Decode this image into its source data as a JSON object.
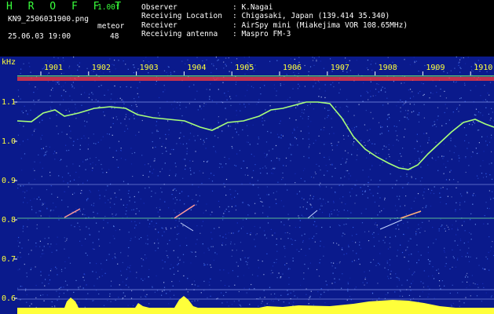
{
  "header": {
    "app_name": "H R O F F T",
    "version": "1.00f",
    "filename": "KN9_2506031900.png",
    "meteor_label": "meteor",
    "meteor_count": "48",
    "datetime": "25.06.03 19:00"
  },
  "info": {
    "rows": [
      {
        "label": "Observer",
        "value": ": K.Nagai"
      },
      {
        "label": "Receiving Location",
        "value": ": Chigasaki, Japan (139.414 35.340)"
      },
      {
        "label": "Receiver",
        "value": ": AirSpy mini (Miakejima VOR 108.65MHz)"
      },
      {
        "label": "Receiving antenna",
        "value": ": Maspro FM-3"
      }
    ]
  },
  "plot": {
    "y_unit": "kHz",
    "y_ticks": [
      "1.1",
      "1.0",
      "0.9",
      "0.8",
      "0.7",
      "0.6"
    ],
    "x_ticks": [
      "1901",
      "1902",
      "1903",
      "1904",
      "1905",
      "1906",
      "1907",
      "1908",
      "1909",
      "1910"
    ],
    "colors": {
      "background": "#0a1a8c",
      "trace": "#a8ff7a",
      "band": "#ff3a3a",
      "histogram": "#ffff3a",
      "base": "#29c8ff",
      "labels": "#ffff3a"
    }
  }
}
